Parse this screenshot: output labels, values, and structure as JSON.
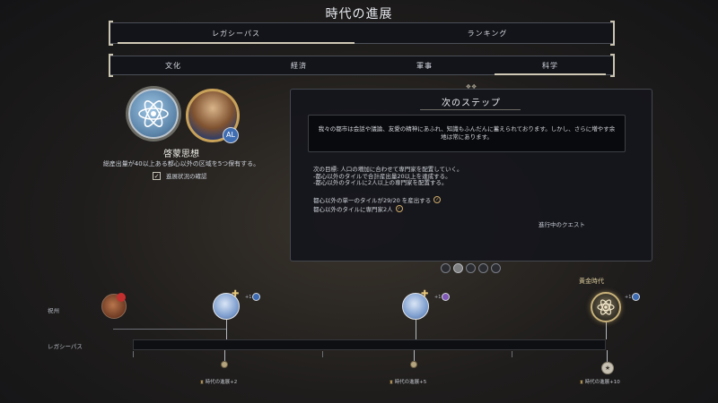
{
  "header": {
    "title": "時代の進展"
  },
  "main_tabs": [
    {
      "label": "レガシーパス",
      "active": true
    },
    {
      "label": "ランキング",
      "active": false
    }
  ],
  "sub_tabs": [
    {
      "label": "文化",
      "active": false
    },
    {
      "label": "経済",
      "active": false
    },
    {
      "label": "軍事",
      "active": false
    },
    {
      "label": "科学",
      "active": true
    }
  ],
  "goal": {
    "icon": "atom-icon",
    "leader_badge": "AL",
    "title": "啓蒙思想",
    "description": "総産出量が40以上ある都心以外の区域を5つ保有する。",
    "track_label": "進展状況の確認",
    "track_checked": true
  },
  "next_steps": {
    "title": "次のステップ",
    "quote": "我々の都市は会話や議論、友愛の精神にあふれ、知識もふんだんに蓄えられております。しかし、さらに増やす余地は常にあります。",
    "objective_lines": [
      "次の目標: 人口の増加に合わせて専門家を配置していく。",
      "-都心以外のタイルで合計産出量20以上を達成する。",
      "-都心以外のタイルに2人以上の専門家を配置する。"
    ],
    "objectives": [
      {
        "text": "都心以外の単一のタイルが29/20 を産出する",
        "done": true
      },
      {
        "text": "都心以外のタイルに専門家2人",
        "done": true
      }
    ],
    "quest_label": "進行中のクエスト"
  },
  "pager": {
    "count": 5,
    "active_index": 1
  },
  "timeline": {
    "row_labels": [
      "祝州",
      "レガシーパス"
    ],
    "golden_age_label": "黄金時代",
    "milestones": [
      {
        "bonus": "+1",
        "reward": "時代の進展+2"
      },
      {
        "bonus": "+1",
        "reward": "時代の進展+5"
      },
      {
        "bonus": "+1",
        "reward": "時代の進展+10"
      }
    ]
  },
  "colors": {
    "accent_gold": "#c9b27a",
    "science_blue": "#7f9fcf",
    "panel_bg": "#14161c"
  }
}
